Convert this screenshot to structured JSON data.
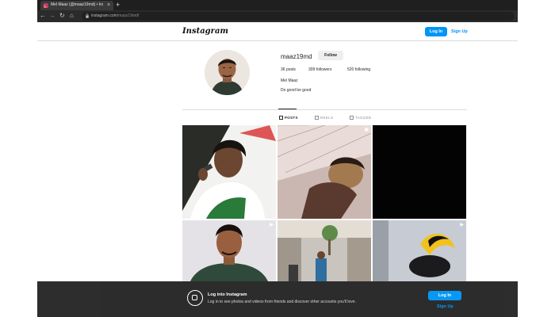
{
  "browser": {
    "tab_title": "Mel Maaz (@maaz19md) • Insta",
    "tab_close": "×",
    "new_tab": "+",
    "url_domain": "instagram.com",
    "url_path": "/maaz19md/",
    "nav": {
      "back": "←",
      "forward": "→",
      "reload": "↻",
      "home": "⌂"
    }
  },
  "header": {
    "logo": "Instagram",
    "login_label": "Log In",
    "signup_label": "Sign Up"
  },
  "profile": {
    "username": "maaz19md",
    "follow_label": "Follow",
    "posts": "36 posts",
    "followers": "309 followers",
    "following": "520 following",
    "full_name": "Mel Maaz",
    "bio": "Do good be good"
  },
  "profile_tabs": [
    {
      "label": "POSTS",
      "active": true,
      "icon": "grid-icon"
    },
    {
      "label": "REELS",
      "active": false,
      "icon": "reels-icon"
    },
    {
      "label": "TAGGED",
      "active": false,
      "icon": "tagged-icon"
    }
  ],
  "posts": [
    {
      "subject": "singer with microphone",
      "badge": ""
    },
    {
      "subject": "man lying on bed",
      "badge": "multiple-icon"
    },
    {
      "subject": "dark photo",
      "badge": ""
    },
    {
      "subject": "portrait selfie",
      "badge": "reel-icon"
    },
    {
      "subject": "mall interior",
      "badge": ""
    },
    {
      "subject": "yellow black bird",
      "badge": "reel-icon"
    }
  ],
  "banner": {
    "title": "Log into Instagram",
    "subtitle": "Log in to see photos and videos from friends and discover other accounts you'll love.",
    "login_label": "Log In",
    "signup_label": "Sign Up"
  },
  "colors": {
    "accent": "#0095f6",
    "tab_strip": "#1f1f1f",
    "banner": "#262626"
  }
}
